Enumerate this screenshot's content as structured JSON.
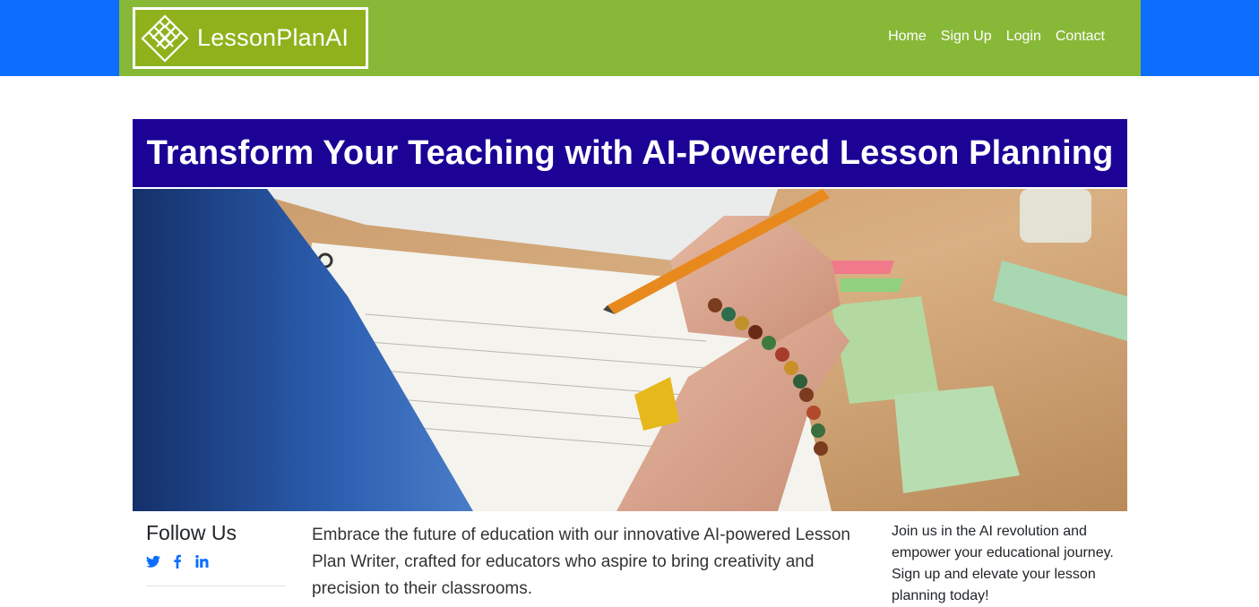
{
  "brand": {
    "name": "LessonPlanAI",
    "logo_icon": "diamond-lattice-logo"
  },
  "nav": {
    "items": [
      {
        "label": "Home"
      },
      {
        "label": "Sign Up"
      },
      {
        "label": "Login"
      },
      {
        "label": "Contact"
      }
    ]
  },
  "hero": {
    "title": "Transform Your Teaching with AI-Powered Lesson Planning",
    "image_subject": "hand writing with pencil in notebook"
  },
  "follow": {
    "heading": "Follow Us",
    "icons": [
      "twitter-icon",
      "facebook-icon",
      "linkedin-icon"
    ]
  },
  "intro": {
    "text": "Embrace the future of education with our innovative AI-powered Lesson Plan Writer, crafted for educators who aspire to bring creativity and precision to their classrooms."
  },
  "cta": {
    "text": "Join us in the AI revolution and empower your educational journey. Sign up and elevate your lesson planning today!"
  },
  "colors": {
    "topbar": "#0d6efd",
    "navbar": "#88b838",
    "logo_bg": "#8fb21c",
    "hero_title_bg": "#1c0396",
    "link": "#0d6efd"
  }
}
